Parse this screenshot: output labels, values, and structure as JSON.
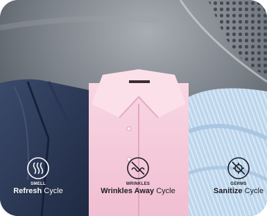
{
  "cycles": [
    {
      "tag": "SMELL",
      "name_bold": "Refresh",
      "name_light": "Cycle",
      "icon": "smell-waves-icon"
    },
    {
      "tag": "WRINKLES",
      "name_bold": "Wrinkles Away",
      "name_light": "Cycle",
      "icon": "wrinkle-slash-icon"
    },
    {
      "tag": "GERMS",
      "name_bold": "Sanitize",
      "name_light": "Cycle",
      "icon": "germ-slash-icon"
    }
  ],
  "colors": {
    "dryer_gray": "#6f7680",
    "suit_navy": "#2e3c5a",
    "shirt_pink": "#f4c6d8",
    "sheets_blue": "#b9d3ea",
    "text_white": "#ffffff",
    "text_dark": "#1c1d24"
  }
}
